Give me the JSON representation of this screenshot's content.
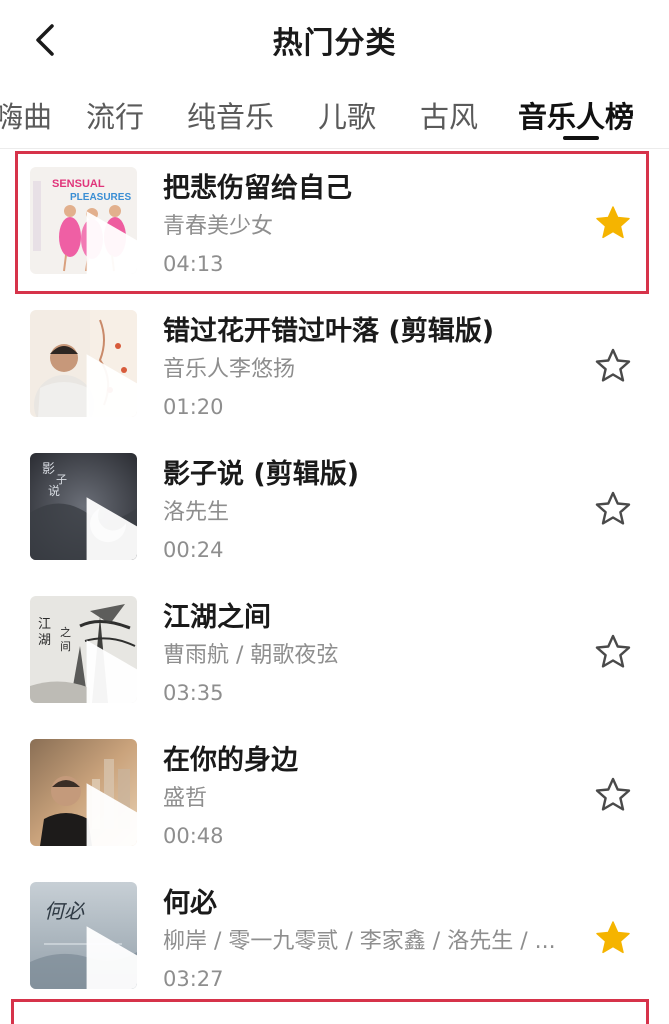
{
  "header": {
    "title": "热门分类",
    "back_icon": "chevron-left-icon"
  },
  "tabs": [
    {
      "label": "嗨曲",
      "active": false
    },
    {
      "label": "流行",
      "active": false
    },
    {
      "label": "纯音乐",
      "active": false
    },
    {
      "label": "儿歌",
      "active": false
    },
    {
      "label": "古风",
      "active": false
    },
    {
      "label": "音乐人榜",
      "active": true
    }
  ],
  "songs": [
    {
      "title": "把悲伤留给自己",
      "artist": "青春美少女",
      "duration": "04:13",
      "favorited": true,
      "cover_text": "SENSUAL PLEASURES"
    },
    {
      "title": "错过花开错过叶落 (剪辑版)",
      "artist": "音乐人李悠扬",
      "duration": "01:20",
      "favorited": false,
      "cover_text": ""
    },
    {
      "title": "影子说 (剪辑版)",
      "artist": "洛先生",
      "duration": "00:24",
      "favorited": false,
      "cover_text": "影子说"
    },
    {
      "title": "江湖之间",
      "artist": "曹雨航 / 朝歌夜弦",
      "duration": "03:35",
      "favorited": false,
      "cover_text": "江湖之间"
    },
    {
      "title": "在你的身边",
      "artist": "盛哲",
      "duration": "00:48",
      "favorited": false,
      "cover_text": ""
    },
    {
      "title": "何必",
      "artist": "柳岸 / 零一九零贰 / 李家鑫 / 洛先生 / ...",
      "duration": "03:27",
      "favorited": true,
      "cover_text": "何必"
    }
  ],
  "colors": {
    "star_filled": "#f5b400",
    "highlight": "#d6334a"
  }
}
